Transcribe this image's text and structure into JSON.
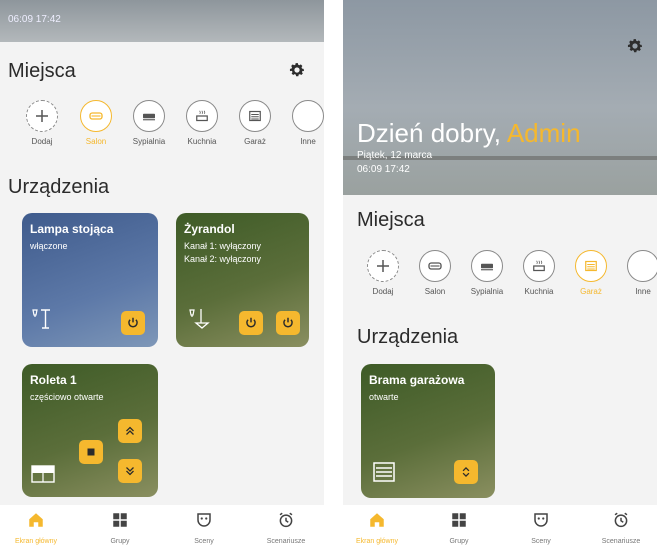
{
  "colors": {
    "accent": "#f5b82e",
    "lampa_card": "#4f6a99",
    "olive_card": "#4d6630",
    "background": "#f3f3f3"
  },
  "left": {
    "header_times": "06:09 17:42",
    "places_title": "Miejsca",
    "places": [
      {
        "label": "Dodaj",
        "icon": "plus-icon",
        "active": false
      },
      {
        "label": "Salon",
        "icon": "sofa-icon",
        "active": true
      },
      {
        "label": "Sypialnia",
        "icon": "bed-icon",
        "active": false
      },
      {
        "label": "Kuchnia",
        "icon": "pot-icon",
        "active": false
      },
      {
        "label": "Garaż",
        "icon": "garage-icon",
        "active": false
      },
      {
        "label": "Inne",
        "icon": "empty-icon",
        "active": false
      }
    ],
    "devices_title": "Urządzenia",
    "devices": {
      "lampa": {
        "title": "Lampa stojąca",
        "status": "włączone"
      },
      "zyrandol": {
        "title": "Żyrandol",
        "line1": "Kanał 1: wyłączony",
        "line2": "Kanał 2: wyłączony"
      },
      "roleta": {
        "title": "Roleta 1",
        "status": "częściowo otwarte"
      }
    }
  },
  "right": {
    "greeting": "Dzień dobry,",
    "user": "Admin",
    "date": "Piątek, 12 marca",
    "times": "06:09 17:42",
    "places_title": "Miejsca",
    "places": [
      {
        "label": "Dodaj",
        "icon": "plus-icon",
        "active": false
      },
      {
        "label": "Salon",
        "icon": "sofa-icon",
        "active": false
      },
      {
        "label": "Sypialnia",
        "icon": "bed-icon",
        "active": false
      },
      {
        "label": "Kuchnia",
        "icon": "pot-icon",
        "active": false
      },
      {
        "label": "Garaż",
        "icon": "garage-icon",
        "active": true
      },
      {
        "label": "Inne",
        "icon": "empty-icon",
        "active": false
      }
    ],
    "devices_title": "Urządzenia",
    "devices": {
      "brama": {
        "title": "Brama garażowa",
        "status": "otwarte"
      }
    }
  },
  "nav": [
    {
      "label": "Ekran główny",
      "icon": "home-icon",
      "active": true
    },
    {
      "label": "Grupy",
      "icon": "grid-icon",
      "active": false
    },
    {
      "label": "Sceny",
      "icon": "mask-icon",
      "active": false
    },
    {
      "label": "Scenariusze",
      "icon": "alarm-clock-icon",
      "active": false
    }
  ]
}
